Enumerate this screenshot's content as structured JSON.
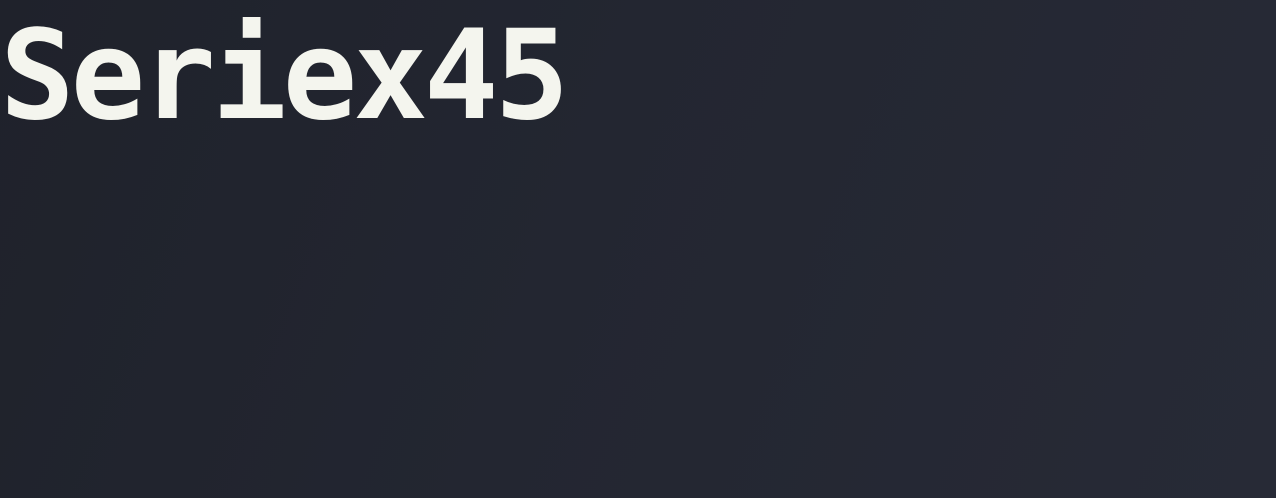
{
  "screen": {
    "title": "Seriex45"
  },
  "colors": {
    "background": "#23262f",
    "title_text": "#f4f5ee"
  }
}
